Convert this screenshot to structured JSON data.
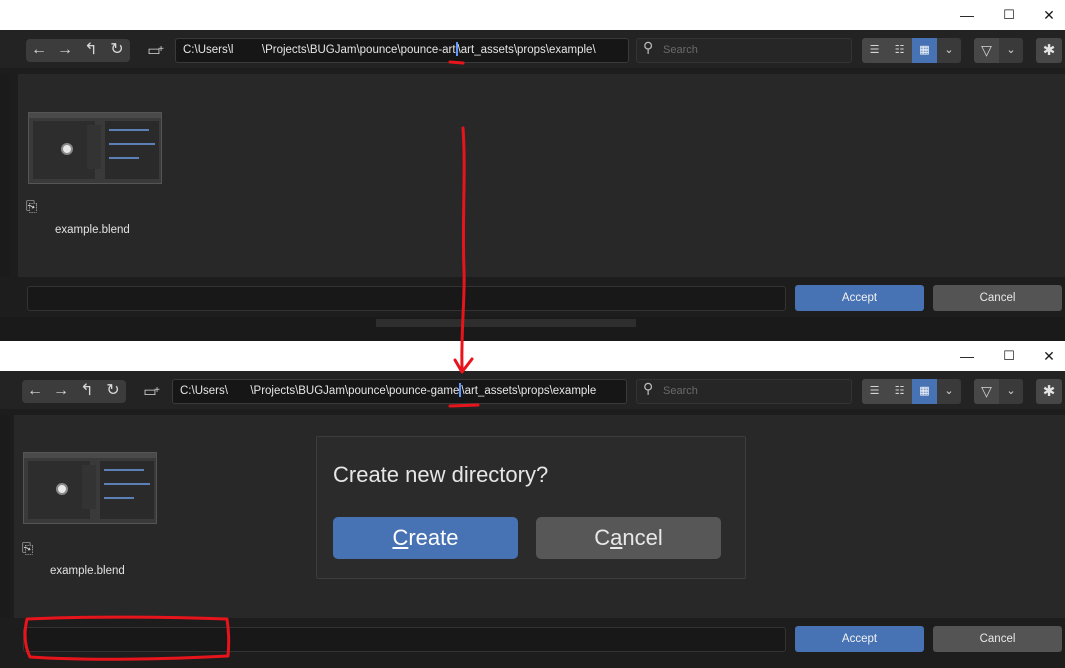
{
  "window_controls": {
    "minimize": "—",
    "maximize": "☐",
    "close": "✕"
  },
  "nav_buttons": [
    {
      "name": "back-button",
      "glyph": "←"
    },
    {
      "name": "forward-button",
      "glyph": "→"
    },
    {
      "name": "parent-directory-button",
      "glyph": "↰"
    },
    {
      "name": "refresh-button",
      "glyph": "↻"
    }
  ],
  "top_window": {
    "path_prefix": "C:\\Users\\l",
    "path_middle": "\\Projects\\BUGJam\\pounce\\pounce-",
    "path_edited": "art",
    "path_suffix": "\\art_assets\\props\\example\\",
    "file": {
      "name": "example.blend"
    }
  },
  "bottom_window": {
    "path_prefix": "C:\\Users\\",
    "path_middle": "\\Projects\\BUGJam\\pounce\\pounce-",
    "path_edited": "game",
    "path_suffix": "\\art_assets\\props\\example",
    "file": {
      "name": "example.blend"
    }
  },
  "search": {
    "placeholder": "Search"
  },
  "accept_label": "Accept",
  "cancel_label": "Cancel",
  "dialog": {
    "title": "Create new directory?",
    "create_label": "Create",
    "create_mnemonic": "C",
    "create_rest": "reate",
    "cancel_label": "Cancel",
    "cancel_pre": "C",
    "cancel_mnemonic": "a",
    "cancel_rest": "ncel"
  },
  "icons": [
    "back-icon",
    "forward-icon",
    "parent-folder-icon",
    "refresh-icon",
    "new-folder-icon",
    "search-icon",
    "list-view-icon",
    "detail-view-icon",
    "thumbnail-view-icon",
    "filter-icon",
    "gear-icon",
    "blend-file-icon"
  ],
  "colors": {
    "accent": "#4772b3",
    "annotation": "#e8141b",
    "background": "#1d1d1d",
    "panel": "#282828"
  }
}
